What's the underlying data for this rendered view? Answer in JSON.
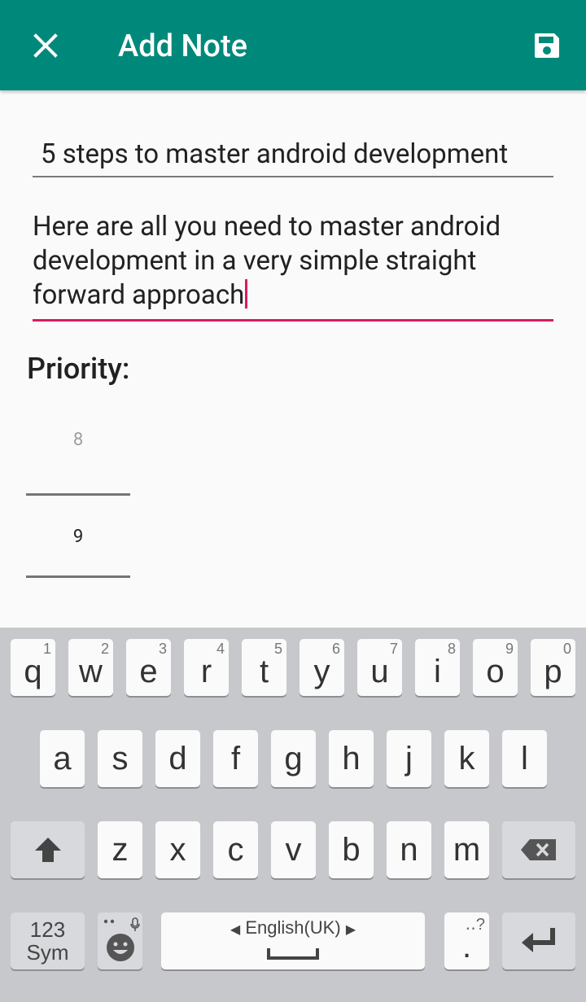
{
  "appbar": {
    "title": "Add Note",
    "close_icon": "close-icon",
    "save_icon": "save-icon",
    "background_color": "#00897b"
  },
  "form": {
    "title_value": "5 steps to master android development",
    "description_value": "Here are all you need to master android development in a very simple straight forward approach",
    "priority_label": "Priority:",
    "picker_values": [
      "8",
      "9"
    ],
    "accent_color": "#d81b60"
  },
  "keyboard": {
    "row1": [
      {
        "letter": "q",
        "hint": "1"
      },
      {
        "letter": "w",
        "hint": "2"
      },
      {
        "letter": "e",
        "hint": "3"
      },
      {
        "letter": "r",
        "hint": "4"
      },
      {
        "letter": "t",
        "hint": "5"
      },
      {
        "letter": "y",
        "hint": "6"
      },
      {
        "letter": "u",
        "hint": "7"
      },
      {
        "letter": "i",
        "hint": "8"
      },
      {
        "letter": "o",
        "hint": "9"
      },
      {
        "letter": "p",
        "hint": "0"
      }
    ],
    "row2": [
      "a",
      "s",
      "d",
      "f",
      "g",
      "h",
      "j",
      "k",
      "l"
    ],
    "row3": [
      "z",
      "x",
      "c",
      "v",
      "b",
      "n",
      "m"
    ],
    "sym_line1": "123",
    "sym_line2": "Sym",
    "space_label": "English(UK)",
    "period_label": ".",
    "period_hint": "‥?",
    "shift_icon": "shift-up-arrow-icon",
    "backspace_icon": "backspace-icon",
    "emoji_icon": "emoji-mic-icon",
    "enter_icon": "enter-icon"
  }
}
